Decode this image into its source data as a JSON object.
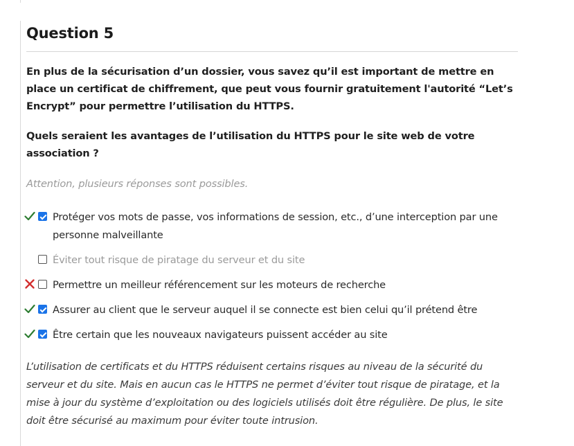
{
  "question": {
    "title": "Question 5",
    "intro": "En plus de la sécurisation d’un dossier, vous savez qu’il est important de mettre en place un certificat de chiffrement, que peut vous fournir gratuitement l'autorité “Let’s Encrypt” pour permettre l’utilisation du HTTPS.",
    "prompt": "Quels seraient les avantages de l’utilisation du HTTPS pour le site web de votre association ?",
    "hint": "Attention, plusieurs réponses sont possibles."
  },
  "answers": [
    {
      "label": "Protéger vos mots de passe, vos informations de session, etc., d’une interception par une personne malveillante",
      "checked": true,
      "result": "correct"
    },
    {
      "label": "Éviter tout risque de piratage du serveur et du site",
      "checked": false,
      "result": "none"
    },
    {
      "label": "Permettre un meilleur référencement sur les moteurs de recherche",
      "checked": false,
      "result": "wrong"
    },
    {
      "label": "Assurer au client que le serveur auquel il se connecte est bien celui qu’il prétend être",
      "checked": true,
      "result": "correct"
    },
    {
      "label": "Être certain que les nouveaux navigateurs puissent accéder au site",
      "checked": true,
      "result": "correct"
    }
  ],
  "explanation": "L’utilisation de certificats et du HTTPS réduisent certains risques au niveau de la sécurité du serveur et du site. Mais en aucun cas le HTTPS ne permet d’éviter tout risque de piratage, et la mise à jour du système d’exploitation ou des logiciels utilisés doit être régulière. De plus, le site doit être sécurisé au maximum pour éviter toute intrusion.",
  "colors": {
    "correct": "#2e7d32",
    "wrong": "#d32f2f",
    "checkbox": "#1a73e8"
  },
  "icons": {
    "correct": "check-icon",
    "wrong": "cross-icon"
  }
}
